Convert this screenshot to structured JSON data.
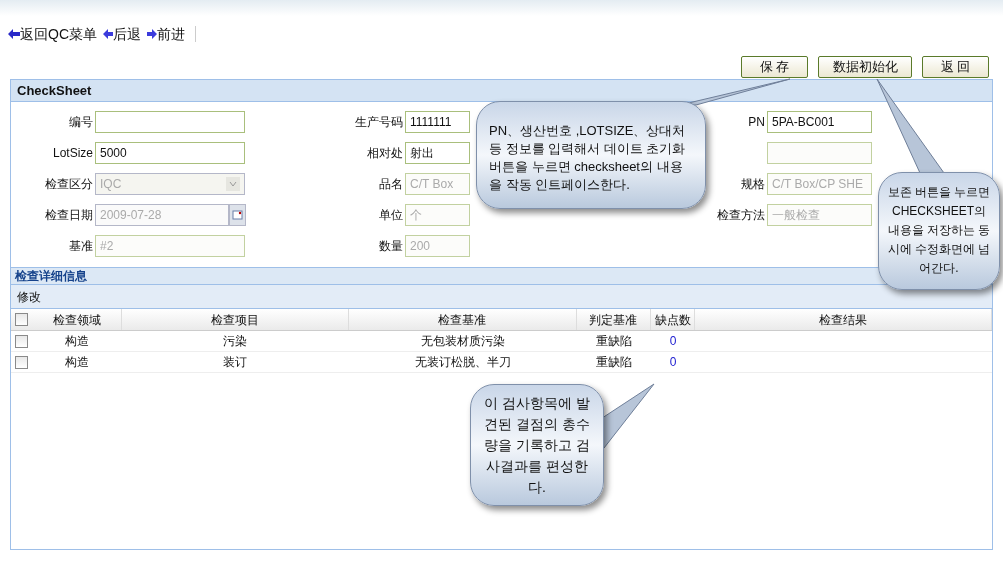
{
  "nav": [
    {
      "kind": "return",
      "label": "返回QC菜单"
    },
    {
      "kind": "back",
      "label": "后退"
    },
    {
      "kind": "forward",
      "label": "前进"
    }
  ],
  "buttons": [
    "保 存",
    "数据初始化",
    "返 回"
  ],
  "form": {
    "title": "CheckSheet",
    "columns": [
      [
        {
          "label": "编号",
          "kind": "text",
          "disabled": false
        },
        {
          "label": "LotSize",
          "value": "5000",
          "kind": "text",
          "disabled": false
        },
        {
          "label": "检查区分",
          "value": "IQC",
          "kind": "select",
          "disabled": true
        },
        {
          "label": "检查日期",
          "value": "2009-07-28",
          "kind": "date",
          "disabled": true
        },
        {
          "label": "基准",
          "value": "#2",
          "kind": "text",
          "disabled": true
        }
      ],
      [
        {
          "label": "生产号码",
          "value": "1111111",
          "kind": "text",
          "disabled": false
        },
        {
          "label": "相对处",
          "value": "射出",
          "kind": "text",
          "disabled": false
        },
        {
          "label": "品名",
          "value": "C/T Box",
          "kind": "text",
          "disabled": true
        },
        {
          "label": "单位",
          "value": "个",
          "kind": "text",
          "disabled": true
        },
        {
          "label": "数量",
          "value": "200",
          "kind": "text",
          "disabled": true
        }
      ],
      [
        {
          "label": "PN",
          "value": "5PA-BC001",
          "kind": "text",
          "disabled": false
        },
        {
          "kind": "text",
          "disabled": true
        },
        {
          "label": "规格",
          "value": "C/T Box/CP SHE",
          "kind": "text",
          "disabled": true
        },
        {
          "label": "检查方法",
          "value": "一般检查",
          "kind": "text",
          "disabled": true
        }
      ]
    ]
  },
  "detail": {
    "title": "检查详细信息",
    "toolbar": "修改",
    "header_checked": false,
    "columns": [
      "检查领域",
      "检查项目",
      "检查基准",
      "判定基准",
      "缺点数",
      "检查结果"
    ],
    "rows": [
      {
        "checked": false,
        "cells": [
          "构造",
          "污染",
          "无包装材质污染",
          "重缺陷",
          "0",
          ""
        ]
      },
      {
        "checked": false,
        "cells": [
          "构造",
          "装订",
          "无装订松脱、半刀",
          "重缺陷",
          "0",
          ""
        ]
      }
    ]
  },
  "callouts": [
    "PN、생산번호 ,LOTSIZE、상대처등 정보를 입력해서 데이트 초기화 버튼을 누르면 checksheet의 내용을 작동 인트페이스한다.",
    "보존 버튼을 누르면 CHECKSHEET의 내용을 저장하는 동시에 수정화면에 넘어간다.",
    "이 검사항목에 발견된 결점의 총수량을 기록하고 검사결과를 편성한다."
  ]
}
